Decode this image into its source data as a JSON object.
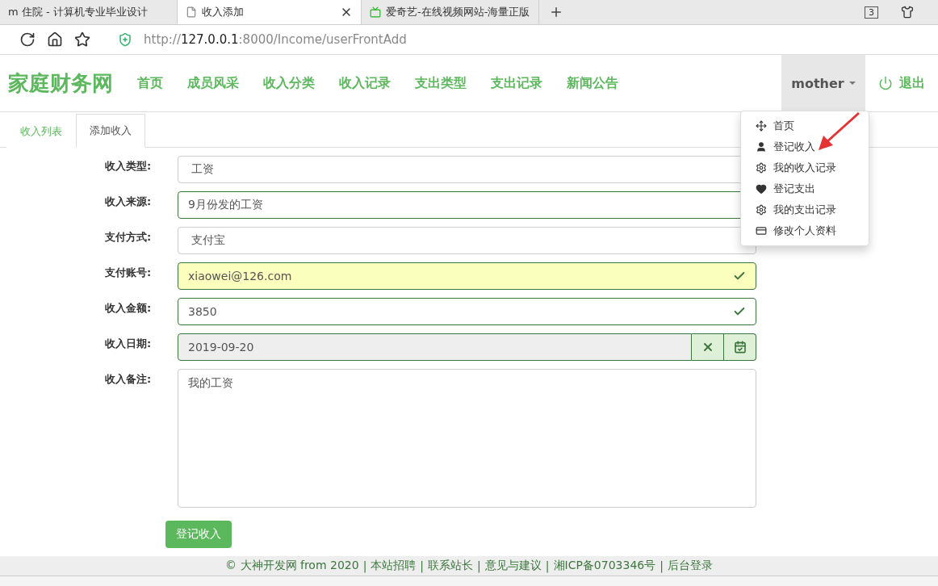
{
  "browser": {
    "tabs": [
      {
        "title": "m 住院 - 计算机专业毕业设计",
        "selected": false
      },
      {
        "title": "收入添加",
        "selected": true
      },
      {
        "title": "爱奇艺-在线视频网站-海量正版",
        "selected": false
      }
    ],
    "tab_count": "3",
    "url": {
      "scheme": "http://",
      "host": "127.0.0.1",
      "path": ":8000/Income/userFrontAdd"
    }
  },
  "navbar": {
    "brand": "家庭财务网",
    "links": [
      "首页",
      "成员风采",
      "收入分类",
      "收入记录",
      "支出类型",
      "支出记录",
      "新闻公告"
    ],
    "user": "mother",
    "logout": "退出"
  },
  "user_menu": {
    "expanded": true,
    "items": [
      {
        "label": "首页"
      },
      {
        "label": "登记收入"
      },
      {
        "label": "我的收入记录"
      },
      {
        "label": "登记支出"
      },
      {
        "label": "我的支出记录"
      },
      {
        "label": "修改个人资料"
      }
    ]
  },
  "subtabs": [
    {
      "label": "收入列表",
      "selected": false
    },
    {
      "label": "添加收入",
      "selected": true
    }
  ],
  "form": {
    "fields": [
      {
        "label": "收入类型:",
        "value": "工资",
        "kind": "plain",
        "valid": false,
        "autofill": false
      },
      {
        "label": "收入来源:",
        "value": "9月份发的工资",
        "kind": "select",
        "valid": true,
        "autofill": false
      },
      {
        "label": "支付方式:",
        "value": "支付宝",
        "kind": "plain",
        "valid": false,
        "autofill": false
      },
      {
        "label": "支付账号:",
        "value": "xiaowei@126.com",
        "kind": "text",
        "valid": true,
        "autofill": true
      },
      {
        "label": "收入金额:",
        "value": "3850",
        "kind": "text",
        "valid": true,
        "autofill": false
      },
      {
        "label": "收入日期:",
        "value": "2019-09-20",
        "kind": "date",
        "valid": true,
        "autofill": false
      },
      {
        "label": "收入备注:",
        "value": "我的工资",
        "kind": "textarea",
        "valid": false,
        "autofill": false
      }
    ],
    "submit": "登记收入"
  },
  "footer": {
    "separator": "|",
    "links": [
      "© 大神开发网 from 2020",
      "本站招聘",
      "联系站长",
      "意见与建议",
      "湘ICP备0703346号",
      "后台登录"
    ]
  }
}
